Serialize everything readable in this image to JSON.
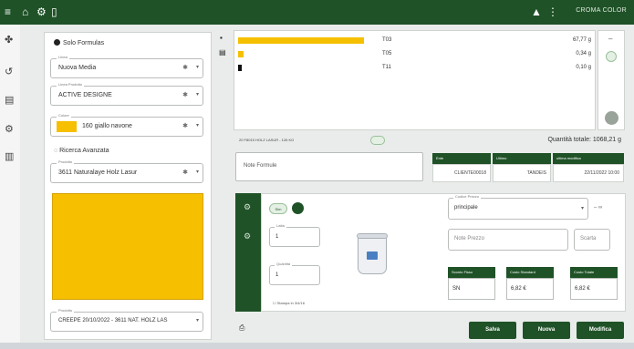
{
  "topbar": {
    "icons": [
      "menu-icon",
      "home-icon",
      "gear-icon",
      "document-icon",
      "bell-icon",
      "info-icon"
    ],
    "brand": "CROMA COLOR"
  },
  "rail": {
    "icons": [
      "palette-icon",
      "history-icon",
      "document-icon",
      "settings-icon",
      "clipboard-icon"
    ]
  },
  "left": {
    "radio_solo": "Solo Formulas",
    "fields": [
      {
        "label": "Linea",
        "value": "Nuova Media"
      },
      {
        "label": "Linea Prodotto",
        "value": "ACTIVE DESIGNE"
      },
      {
        "label": "Colore",
        "value": "160 giallo navone"
      }
    ],
    "radio_ricerca": "Ricerca Avanzata",
    "field4": {
      "label": "Prodotto",
      "value": "3611 Naturalaye Holz Lasur"
    },
    "bottom_field": {
      "label": "Prodotto",
      "value": "CREEPE 20/10/2022 - 3611 NAT. HOLZ LAS"
    },
    "swatch_color": "#f6bf00"
  },
  "list": {
    "rows": [
      {
        "code": "T03",
        "qty": "67,77 g",
        "fill": 0.6
      },
      {
        "code": "T05",
        "qty": "0,34 g",
        "fill": 0.03
      },
      {
        "code": "T11",
        "qty": "0,10 g",
        "fill": 0.0
      }
    ]
  },
  "summary": {
    "status": "20 F8015 HOLZ LASUR - 126 KG",
    "total": "Quantità totale: 1068,21 g"
  },
  "note": {
    "placeholder": "Note Formule"
  },
  "info": {
    "cols": [
      {
        "head": "Ente",
        "value": "CLIENTE00018"
      },
      {
        "head": "Ultimo",
        "value": "TANDEIS"
      },
      {
        "head": "ultima modifica",
        "value": "22/11/2022 10:00"
      }
    ]
  },
  "recipe": {
    "pill": "Sim",
    "inputs": [
      {
        "label": "Latta",
        "value": "1"
      },
      {
        "label": "Quantità",
        "value": "1"
      }
    ],
    "checkbox": "Stampa in 3/4/16",
    "tipo": {
      "label": "Codice Prezzo",
      "value": "principale"
    },
    "note_prezzo": "Note Prezzo",
    "note_btn": "Scarta",
    "cards": [
      {
        "head": "Sconto Fisso",
        "value": "SN"
      },
      {
        "head": "Costo Standard",
        "value": "6,82 €"
      },
      {
        "head": "Costo Totale",
        "value": "6,82 €"
      }
    ]
  },
  "buttons": {
    "save": "Salva",
    "new": "Nuova",
    "modify": "Modifica"
  }
}
